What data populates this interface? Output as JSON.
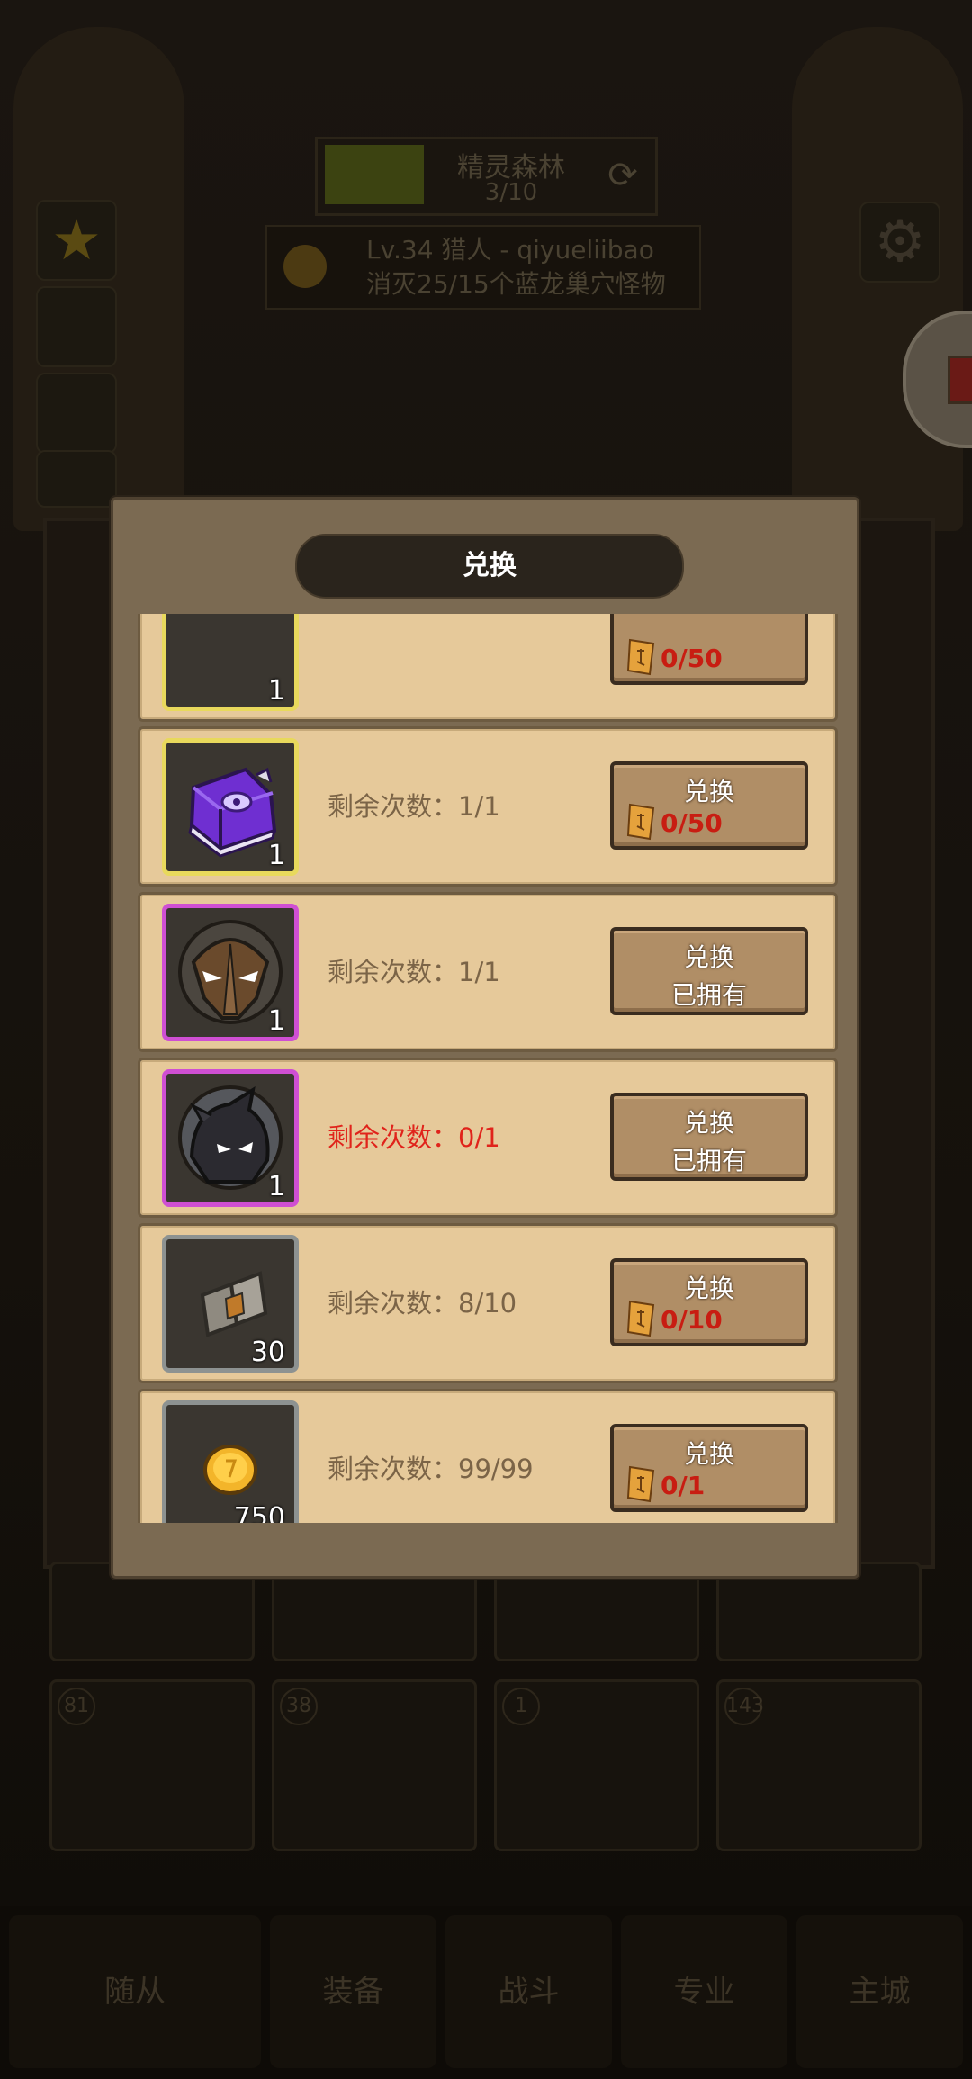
{
  "background": {
    "area_name": "精灵森林",
    "area_progress": "3/10",
    "quest_line1": "Lv.34 猎人 - qiyueliibao",
    "quest_line2": "消灭25/15个蓝龙巢穴怪物",
    "hero_levels": [
      "81",
      "38",
      "1",
      "143"
    ],
    "nav_tabs": [
      "随从",
      "装备",
      "战斗",
      "专业",
      "主城"
    ]
  },
  "dialog": {
    "title": "兑换",
    "partial_row": {
      "count": "1",
      "cost": "0/50"
    },
    "rows": [
      {
        "icon": "purple-book-icon",
        "count": "1",
        "remaining": "剩余次数：1/1",
        "exhausted": false,
        "button_label": "兑换",
        "cost": "0/50",
        "owned": null
      },
      {
        "icon": "brown-mask-avatar-icon",
        "count": "1",
        "remaining": "剩余次数：1/1",
        "exhausted": false,
        "button_label": "兑换",
        "cost": null,
        "owned": "已拥有"
      },
      {
        "icon": "dark-dragon-avatar-icon",
        "count": "1",
        "remaining": "剩余次数：0/1",
        "exhausted": true,
        "button_label": "兑换",
        "cost": null,
        "owned": "已拥有"
      },
      {
        "icon": "scroll-fragment-icon",
        "count": "30",
        "remaining": "剩余次数：8/10",
        "exhausted": false,
        "button_label": "兑换",
        "cost": "0/10",
        "owned": null
      },
      {
        "icon": "gold-coin-icon",
        "count": "750",
        "remaining": "剩余次数：99/99",
        "exhausted": false,
        "button_label": "兑换",
        "cost": "0/1",
        "owned": null
      }
    ]
  },
  "colors": {
    "dialog_bg": "#7b6a52",
    "row_bg": "#e6c99a",
    "button_bg": "#b08e66",
    "cost_red": "#c81d12",
    "exhausted_red": "#e0231b",
    "gold_frame": "#e8d95c",
    "purple_frame": "#cf4fd3"
  }
}
